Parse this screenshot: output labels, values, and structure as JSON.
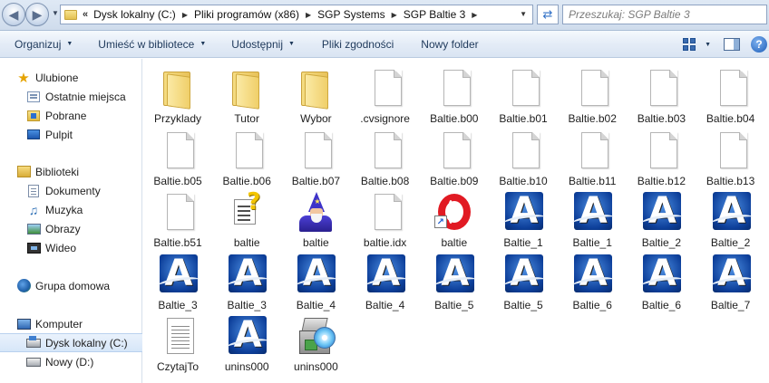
{
  "address": {
    "overflow_marker": "«",
    "crumbs": [
      "Dysk lokalny (C:)",
      "Pliki programów (x86)",
      "SGP Systems",
      "SGP Baltie 3"
    ],
    "search_placeholder": "Przeszukaj: SGP Baltie 3"
  },
  "toolbar": {
    "organize": "Organizuj",
    "include": "Umieść w bibliotece",
    "share": "Udostępnij",
    "burn": "Pliki zgodności",
    "new_folder": "Nowy folder"
  },
  "nav": {
    "favorites": "Ulubione",
    "recent": "Ostatnie miejsca",
    "downloads": "Pobrane",
    "desktop": "Pulpit",
    "libraries": "Biblioteki",
    "documents": "Dokumenty",
    "music": "Muzyka",
    "pictures": "Obrazy",
    "videos": "Wideo",
    "homegroup": "Grupa domowa",
    "computer": "Komputer",
    "drive_c": "Dysk lokalny (C:)",
    "drive_d": "Nowy (D:)"
  },
  "colors": {
    "accent": "#1e395b",
    "selection": "#d6e6f8"
  },
  "files": [
    {
      "name": "Przyklady",
      "icon": "folder-icon"
    },
    {
      "name": "Tutor",
      "icon": "folder-icon"
    },
    {
      "name": "Wybor",
      "icon": "folder-icon"
    },
    {
      "name": ".cvsignore",
      "icon": "blank-file-icon"
    },
    {
      "name": "Baltie.b00",
      "icon": "blank-file-icon"
    },
    {
      "name": "Baltie.b01",
      "icon": "blank-file-icon"
    },
    {
      "name": "Baltie.b02",
      "icon": "blank-file-icon"
    },
    {
      "name": "Baltie.b03",
      "icon": "blank-file-icon"
    },
    {
      "name": "Baltie.b04",
      "icon": "blank-file-icon"
    },
    {
      "name": "Baltie.b05",
      "icon": "blank-file-icon"
    },
    {
      "name": "Baltie.b06",
      "icon": "blank-file-icon"
    },
    {
      "name": "Baltie.b07",
      "icon": "blank-file-icon"
    },
    {
      "name": "Baltie.b08",
      "icon": "blank-file-icon"
    },
    {
      "name": "Baltie.b09",
      "icon": "blank-file-icon"
    },
    {
      "name": "Baltie.b10",
      "icon": "blank-file-icon"
    },
    {
      "name": "Baltie.b11",
      "icon": "blank-file-icon"
    },
    {
      "name": "Baltie.b12",
      "icon": "blank-file-icon"
    },
    {
      "name": "Baltie.b13",
      "icon": "blank-file-icon"
    },
    {
      "name": "Baltie.b51",
      "icon": "blank-file-icon"
    },
    {
      "name": "baltie",
      "icon": "help-file-icon"
    },
    {
      "name": "baltie",
      "icon": "wizard-icon"
    },
    {
      "name": "baltie.idx",
      "icon": "blank-file-icon"
    },
    {
      "name": "baltie",
      "icon": "opera-shortcut-icon"
    },
    {
      "name": "Baltie_1",
      "icon": "baltie-logo-icon"
    },
    {
      "name": "Baltie_1",
      "icon": "baltie-logo-icon"
    },
    {
      "name": "Baltie_2",
      "icon": "baltie-logo-icon"
    },
    {
      "name": "Baltie_2",
      "icon": "baltie-logo-icon"
    },
    {
      "name": "Baltie_3",
      "icon": "baltie-logo-icon"
    },
    {
      "name": "Baltie_3",
      "icon": "baltie-logo-icon"
    },
    {
      "name": "Baltie_4",
      "icon": "baltie-logo-icon"
    },
    {
      "name": "Baltie_4",
      "icon": "baltie-logo-icon"
    },
    {
      "name": "Baltie_5",
      "icon": "baltie-logo-icon"
    },
    {
      "name": "Baltie_5",
      "icon": "baltie-logo-icon"
    },
    {
      "name": "Baltie_6",
      "icon": "baltie-logo-icon"
    },
    {
      "name": "Baltie_6",
      "icon": "baltie-logo-icon"
    },
    {
      "name": "Baltie_7",
      "icon": "baltie-logo-icon"
    },
    {
      "name": "CzytajTo",
      "icon": "text-file-icon"
    },
    {
      "name": "unins000",
      "icon": "baltie-logo-icon"
    },
    {
      "name": "unins000",
      "icon": "installer-icon"
    }
  ]
}
